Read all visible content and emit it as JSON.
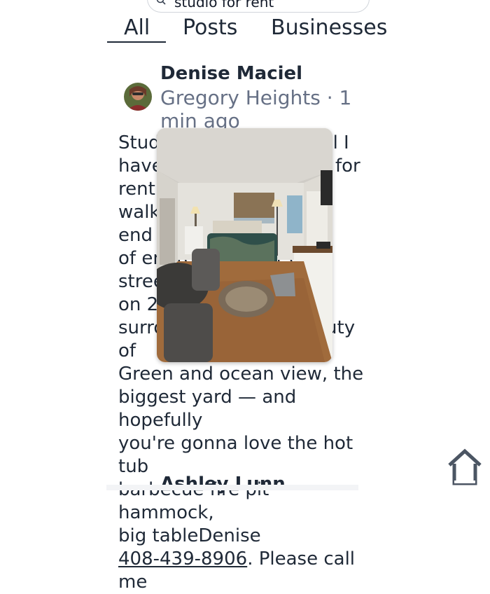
{
  "search": {
    "query": "studio for rent"
  },
  "tabs": [
    {
      "label": "All",
      "active": true
    },
    {
      "label": "Posts",
      "active": false
    },
    {
      "label": "Businesses",
      "active": false
    }
  ],
  "post": {
    "author": "Denise Maciel",
    "meta": "Gregory Heights · 1 min ago",
    "body_lines": [
      "Studio apartment — will I",
      "have a studio available for",
      "rent — it's just minutes",
      "walking distance to the end",
      "of entire and right on street",
      "on 2 acres, completely",
      "surrounded by the beauty of",
      "Green and ocean view, the",
      "biggest yard — and hopefully",
      "you're gonna love the hot tub",
      "barbecue fire pit hammock,",
      "big tableDenise"
    ],
    "phone": "408-439-8906",
    "after_phone": ". Please call",
    "last_line": "me"
  },
  "next_post": {
    "author": "Ashley Lunn"
  },
  "colors": {
    "text": "#1f2937",
    "muted": "#667085",
    "home_icon": "#4b5563"
  },
  "icons": {
    "back": "back-arrow-icon",
    "search": "search-icon",
    "home": "home-icon"
  }
}
